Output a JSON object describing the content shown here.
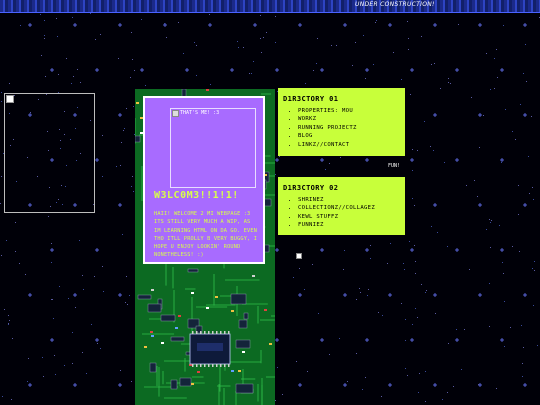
{
  "banner": {
    "text": "under construction!"
  },
  "left_image": {
    "icon": "broken-image-icon"
  },
  "welcome": {
    "photo_alt": "that's me! :3",
    "title": "W3LC0M3!!1!1!",
    "body": "HAII! WELCOME 2 MI WEBPAGE :3 ITS STILL VERY MUCH A WIP, AS IM LEARNING HTML ON DA GO. EVEN THO ITLL PROLLY B VERY BUGGY, I HOPE U ENJOY LOOKIN' ROUND NONETHELESS! :)"
  },
  "directory1": {
    "title": "D1R3CTORY 01",
    "items": [
      "PROPERTIES: MOU",
      "WORKZ",
      "RUNNING PROJECTZ",
      "BLOG",
      "LINKZ//CONTACT"
    ]
  },
  "fun_label": "FUN!",
  "directory2": {
    "title": "D1R3CTORY 02",
    "items": [
      "SHRINEZ",
      "COLLECTIONZ//COLLAGEZ",
      "KEWL STUFFZ",
      "FUNNIEZ"
    ]
  },
  "colors": {
    "background": "#000008",
    "accent": "#c8ff3a",
    "panel": "#a86bff",
    "board": "#0c6a22"
  }
}
